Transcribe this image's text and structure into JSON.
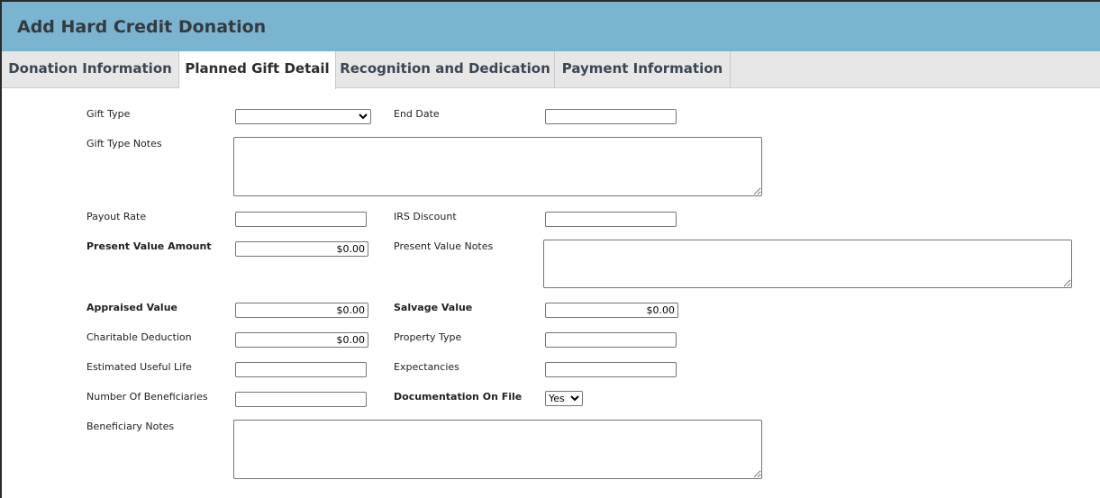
{
  "window": {
    "title": "Add Hard Credit Donation"
  },
  "tabs": [
    {
      "label": "Donation Information",
      "active": false
    },
    {
      "label": "Planned Gift Detail",
      "active": true
    },
    {
      "label": "Recognition and Dedication",
      "active": false
    },
    {
      "label": "Payment Information",
      "active": false
    }
  ],
  "form": {
    "gift_type": {
      "label": "Gift Type",
      "value": ""
    },
    "end_date": {
      "label": "End Date",
      "value": ""
    },
    "gift_type_notes": {
      "label": "Gift Type Notes",
      "value": ""
    },
    "payout_rate": {
      "label": "Payout Rate",
      "value": ""
    },
    "irs_discount": {
      "label": "IRS Discount",
      "value": ""
    },
    "present_value_amount": {
      "label": "Present Value Amount",
      "value": "$0.00"
    },
    "present_value_notes": {
      "label": "Present Value Notes",
      "value": ""
    },
    "appraised_value": {
      "label": "Appraised Value",
      "value": "$0.00"
    },
    "salvage_value": {
      "label": "Salvage Value",
      "value": "$0.00"
    },
    "charitable_deduction": {
      "label": "Charitable Deduction",
      "value": "$0.00"
    },
    "property_type": {
      "label": "Property Type",
      "value": ""
    },
    "estimated_useful_life": {
      "label": "Estimated Useful Life",
      "value": ""
    },
    "expectancies": {
      "label": "Expectancies",
      "value": ""
    },
    "number_of_beneficiaries": {
      "label": "Number Of Beneficiaries",
      "value": ""
    },
    "documentation_on_file": {
      "label": "Documentation On File",
      "value": "Yes"
    },
    "beneficiary_notes": {
      "label": "Beneficiary Notes",
      "value": ""
    }
  },
  "colors": {
    "titlebar": "#7bb4d0",
    "tabbar": "#e7e7e7",
    "accent_text": "#3c4752"
  },
  "icons": {
    "select_arrow": "chevron-down-icon"
  }
}
